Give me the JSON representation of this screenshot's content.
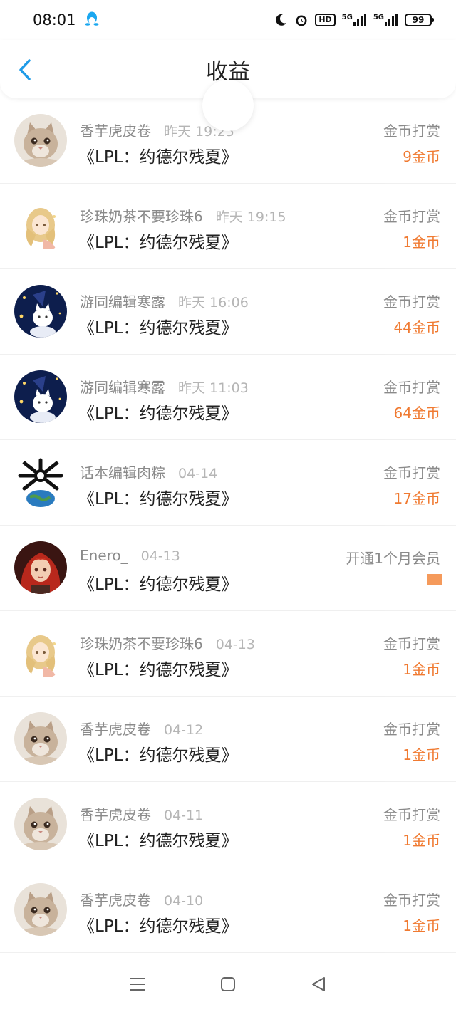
{
  "status_bar": {
    "time": "08:01",
    "hd_label": "HD",
    "network_1": "5G",
    "network_2": "5G",
    "battery": "99",
    "icons": [
      "qq-penguin-icon",
      "moon-icon",
      "alarm-icon",
      "signal-icon",
      "signal-icon"
    ]
  },
  "header": {
    "title": "收益",
    "back_icon": "chevron-left-icon",
    "accent_color": "#1e9be8"
  },
  "colors": {
    "amount": "#f07a31",
    "meta_text": "#8a8a8a",
    "time_text": "#b5b5b5",
    "work_text": "#222222"
  },
  "items": [
    {
      "user": "香芋虎皮卷",
      "time": "昨天 19:25",
      "work": "《LPL：约德尔残夏》",
      "type": "金币打赏",
      "amount": "9金币",
      "avatar": "cat"
    },
    {
      "user": "珍珠奶茶不要珍珠6",
      "time": "昨天 19:15",
      "work": "《LPL：约德尔残夏》",
      "type": "金币打赏",
      "amount": "1金币",
      "avatar": "anime-girl-blonde"
    },
    {
      "user": "游同编辑寒露",
      "time": "昨天 16:06",
      "work": "《LPL：约德尔残夏》",
      "type": "金币打赏",
      "amount": "44金币",
      "avatar": "night-sky-cat"
    },
    {
      "user": "游同编辑寒露",
      "time": "昨天 11:03",
      "work": "《LPL：约德尔残夏》",
      "type": "金币打赏",
      "amount": "64金币",
      "avatar": "night-sky-cat"
    },
    {
      "user": "话本编辑肉粽",
      "time": "04-14",
      "work": "《LPL：约德尔残夏》",
      "type": "金币打赏",
      "amount": "17金币",
      "avatar": "earth-spider"
    },
    {
      "user": "Enero_",
      "time": "04-13",
      "work": "《LPL：约德尔残夏》",
      "type": "开通1个月会员",
      "amount": "",
      "avatar": "red-hair-girl"
    },
    {
      "user": "珍珠奶茶不要珍珠6",
      "time": "04-13",
      "work": "《LPL：约德尔残夏》",
      "type": "金币打赏",
      "amount": "1金币",
      "avatar": "anime-girl-blonde"
    },
    {
      "user": "香芋虎皮卷",
      "time": "04-12",
      "work": "《LPL：约德尔残夏》",
      "type": "金币打赏",
      "amount": "1金币",
      "avatar": "cat"
    },
    {
      "user": "香芋虎皮卷",
      "time": "04-11",
      "work": "《LPL：约德尔残夏》",
      "type": "金币打赏",
      "amount": "1金币",
      "avatar": "cat"
    },
    {
      "user": "香芋虎皮卷",
      "time": "04-10",
      "work": "《LPL：约德尔残夏》",
      "type": "金币打赏",
      "amount": "1金币",
      "avatar": "cat"
    }
  ],
  "nav_bar": {
    "icons": [
      "menu-icon",
      "home-square-icon",
      "back-triangle-icon"
    ]
  }
}
